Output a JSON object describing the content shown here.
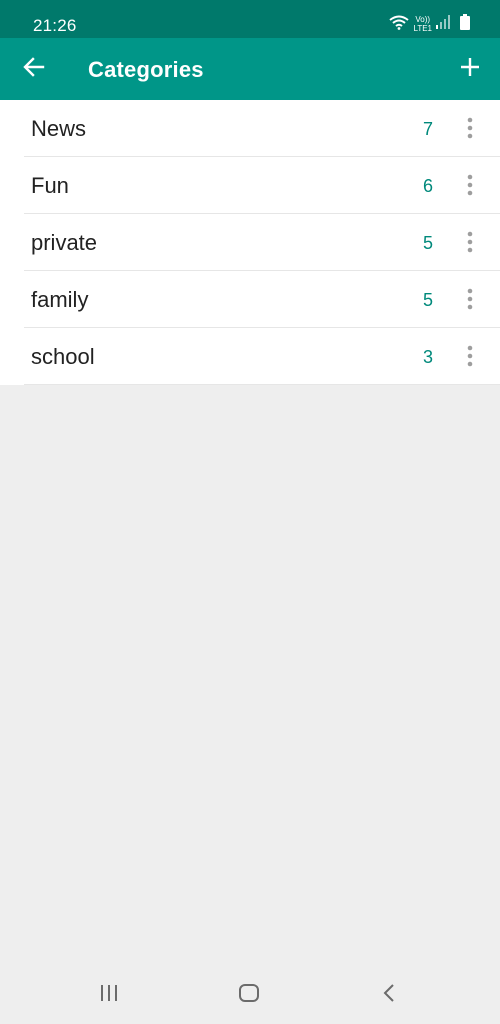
{
  "status_bar": {
    "time": "21:26",
    "network_label_top": "Vo))",
    "network_label_bottom": "LTE1",
    "icons": [
      "wifi-icon",
      "signal-icon",
      "battery-icon"
    ]
  },
  "app_bar": {
    "title": "Categories",
    "back_icon": "arrow-left-icon",
    "add_icon": "plus-icon"
  },
  "categories": [
    {
      "name": "News",
      "count": "7"
    },
    {
      "name": "Fun",
      "count": "6"
    },
    {
      "name": "private",
      "count": "5"
    },
    {
      "name": "family",
      "count": "5"
    },
    {
      "name": "school",
      "count": "3"
    }
  ],
  "nav_bar": {
    "icons": [
      "recent-apps-icon",
      "home-icon",
      "back-icon"
    ]
  },
  "colors": {
    "status_bar": "#00796b",
    "app_bar": "#009688",
    "count": "#00897b",
    "background": "#eeeeee"
  }
}
